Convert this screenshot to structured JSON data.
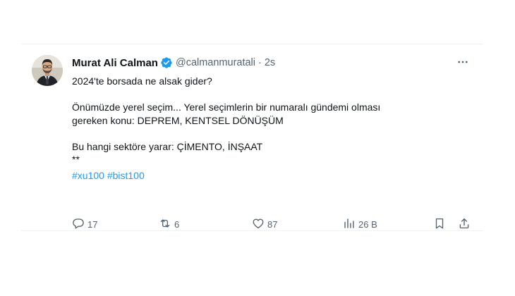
{
  "tweet": {
    "author": {
      "display_name": "Murat Ali Calman",
      "handle": "@calmanmuratali",
      "separator": "·",
      "time": "2s",
      "verified": true
    },
    "text_lines": [
      "2024'te borsada ne alsak gider?",
      "",
      "Önümüzde yerel seçim... Yerel seçimlerin bir numaralı gündemi olması",
      "gereken konu: DEPREM, KENTSEL DÖNÜŞÜM",
      "",
      "Bu hangi sektöre yarar: ÇİMENTO, İNŞAAT",
      "**"
    ],
    "hashtags": [
      "#xu100",
      "#bist100"
    ],
    "metrics": {
      "replies": "17",
      "retweets": "6",
      "likes": "87",
      "views": "26 B"
    }
  },
  "icons": {
    "verified": "verified-badge-icon",
    "more": "more-options-icon",
    "reply": "reply-icon",
    "retweet": "retweet-icon",
    "like": "heart-icon",
    "views": "views-icon",
    "bookmark": "bookmark-icon",
    "share": "share-icon"
  },
  "colors": {
    "accent": "#1d9bf0",
    "text": "#0f1419",
    "secondary": "#536471"
  }
}
